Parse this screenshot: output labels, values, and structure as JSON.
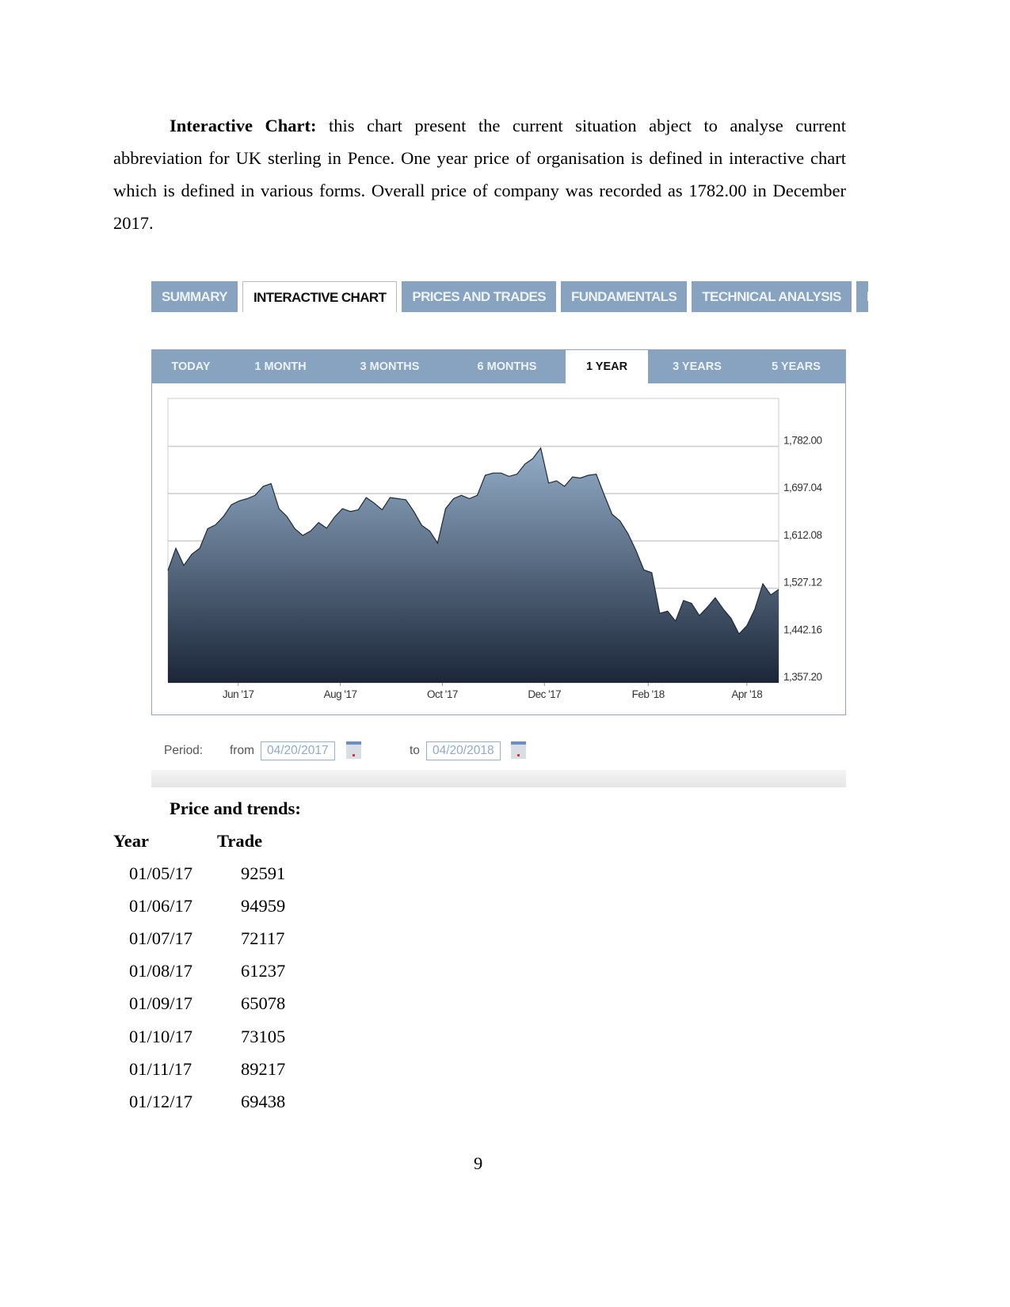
{
  "paragraph": {
    "lead": "Interactive Chart:",
    "body": " this chart present the current situation abject to analyse current abbreviation for UK sterling in Pence. One year price of organisation is defined in interactive chart which is defined in various forms. Overall price of company was recorded as 1782.00 in December 2017."
  },
  "tabs": [
    {
      "label": "SUMMARY",
      "active": false
    },
    {
      "label": "INTERACTIVE CHART",
      "active": true
    },
    {
      "label": "PRICES AND TRADES",
      "active": false
    },
    {
      "label": "FUNDAMENTALS",
      "active": false
    },
    {
      "label": "TECHNICAL ANALYSIS",
      "active": false
    },
    {
      "label": "NEWS AND ANALYSIS",
      "active": false
    }
  ],
  "ranges": [
    {
      "label": "TODAY",
      "active": false
    },
    {
      "label": "1 MONTH",
      "active": false
    },
    {
      "label": "3 MONTHS",
      "active": false
    },
    {
      "label": "6 MONTHS",
      "active": false
    },
    {
      "label": "1 YEAR",
      "active": true
    },
    {
      "label": "3 YEARS",
      "active": false
    },
    {
      "label": "5 YEARS",
      "active": false
    }
  ],
  "chart_data": {
    "type": "area",
    "x_range": [
      "2017-04-20",
      "2018-04-20"
    ],
    "x_ticks": [
      "Jun '17",
      "Aug '17",
      "Oct '17",
      "Dec '17",
      "Feb '18",
      "Apr '18"
    ],
    "x_tick_dates": [
      "2017-06-01",
      "2017-08-01",
      "2017-10-01",
      "2017-12-01",
      "2018-02-01",
      "2018-04-01"
    ],
    "y_ticks": [
      "1,782.00",
      "1,697.04",
      "1,612.08",
      "1,527.12",
      "1,442.16",
      "1,357.20"
    ],
    "y_tick_values": [
      1782.0,
      1697.04,
      1612.08,
      1527.12,
      1442.16,
      1357.2
    ],
    "ylim": [
      1357.2,
      1868
    ],
    "grid": true,
    "y_axis_side": "right",
    "values_note_evenly_spaced_over_period": true,
    "values": [
      1559,
      1599,
      1568,
      1588,
      1599,
      1634,
      1641,
      1656,
      1677,
      1684,
      1688,
      1694,
      1710,
      1715,
      1670,
      1656,
      1634,
      1622,
      1630,
      1645,
      1635,
      1655,
      1670,
      1665,
      1668,
      1690,
      1680,
      1668,
      1690,
      1688,
      1686,
      1665,
      1640,
      1630,
      1608,
      1670,
      1688,
      1694,
      1688,
      1694,
      1730,
      1734,
      1734,
      1728,
      1732,
      1750,
      1760,
      1779,
      1716,
      1720,
      1710,
      1727,
      1725,
      1730,
      1732,
      1695,
      1660,
      1648,
      1625,
      1595,
      1560,
      1555,
      1482,
      1486,
      1468,
      1505,
      1500,
      1478,
      1493,
      1510,
      1490,
      1473,
      1445,
      1460,
      1490,
      1535,
      1515,
      1525
    ],
    "colors": {
      "fill_top": "#93adc8",
      "fill_bottom": "#1b2638",
      "line": "#1e2a3a",
      "grid": "#cccccc"
    }
  },
  "period": {
    "label": "Period:",
    "from_label": "from",
    "from_value": "04/20/2017",
    "to_label": "to",
    "to_value": "04/20/2018"
  },
  "table": {
    "title": "Price and trends:",
    "headers": [
      "Year",
      "Trade"
    ],
    "rows": [
      [
        "01/05/17",
        "92591"
      ],
      [
        "01/06/17",
        "94959"
      ],
      [
        "01/07/17",
        "72117"
      ],
      [
        "01/08/17",
        "61237"
      ],
      [
        "01/09/17",
        "65078"
      ],
      [
        "01/10/17",
        "73105"
      ],
      [
        "01/11/17",
        "89217"
      ],
      [
        "01/12/17",
        "69438"
      ]
    ]
  },
  "page_number": "9"
}
